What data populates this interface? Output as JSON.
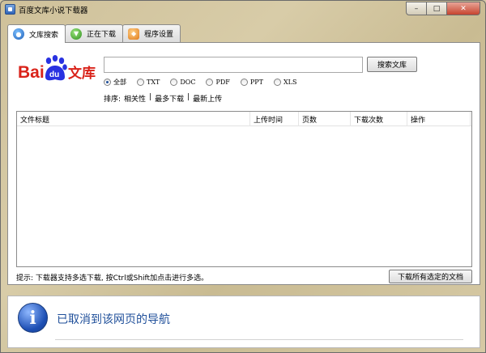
{
  "window": {
    "title": "百度文库小说下载器"
  },
  "tabs": [
    {
      "label": "文库搜索"
    },
    {
      "label": "正在下载"
    },
    {
      "label": "程序设置"
    }
  ],
  "logo": {
    "prefix": "Bai",
    "paw_text": "du",
    "suffix": "文库"
  },
  "search": {
    "value": "",
    "button_label": "搜索文库"
  },
  "filters": [
    {
      "label": "全部",
      "checked": true
    },
    {
      "label": "TXT",
      "checked": false
    },
    {
      "label": "DOC",
      "checked": false
    },
    {
      "label": "PDF",
      "checked": false
    },
    {
      "label": "PPT",
      "checked": false
    },
    {
      "label": "XLS",
      "checked": false
    }
  ],
  "sort": {
    "label": "排序:",
    "options": [
      "相关性",
      "最多下载",
      "最新上传"
    ],
    "separator": "|"
  },
  "table": {
    "columns": [
      "文件标题",
      "上传时间",
      "页数",
      "下载次数",
      "操作"
    ]
  },
  "footer": {
    "hint": "提示: 下载器支持多选下载, 按Ctrl或Shift加点击进行多选。",
    "download_all_label": "下载所有选定的文档"
  },
  "infobar": {
    "message": "已取消到该网页的导航"
  },
  "colors": {
    "baidu_red": "#d9231a",
    "baidu_blue": "#2932e1",
    "info_blue": "#1f4f9a"
  }
}
